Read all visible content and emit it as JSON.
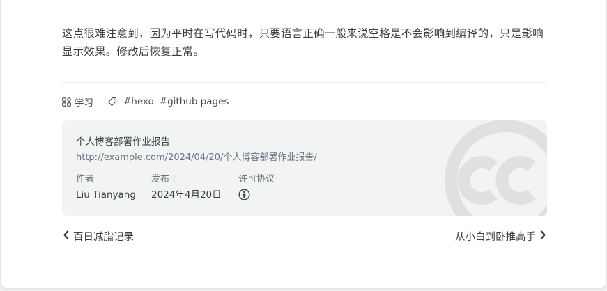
{
  "article": {
    "paragraph": "这点很难注意到，因为平时在写代码时，只要语言正确一般来说空格是不会影响到编译的，只是影响显示效果。修改后恢复正常。"
  },
  "meta": {
    "category": "学习",
    "tags": [
      "#hexo",
      "#github pages"
    ]
  },
  "license": {
    "title": "个人博客部署作业报告",
    "link": "http://example.com/2024/04/20/个人博客部署作业报告/",
    "author_label": "作者",
    "author": "Liu Tianyang",
    "date_label": "发布于",
    "date": "2024年4月20日",
    "license_label": "许可协议",
    "license_icon": "cc-by-icon",
    "watermark_icon": "creative-commons-icon"
  },
  "nav": {
    "prev": "百日减脂记录",
    "next": "从小白到卧推高手"
  },
  "colors": {
    "card": "#ffffff",
    "page_bg": "#f3f4f5",
    "license_bg": "#f2f3f3",
    "text": "#3a3f45",
    "link": "#6a7480"
  }
}
